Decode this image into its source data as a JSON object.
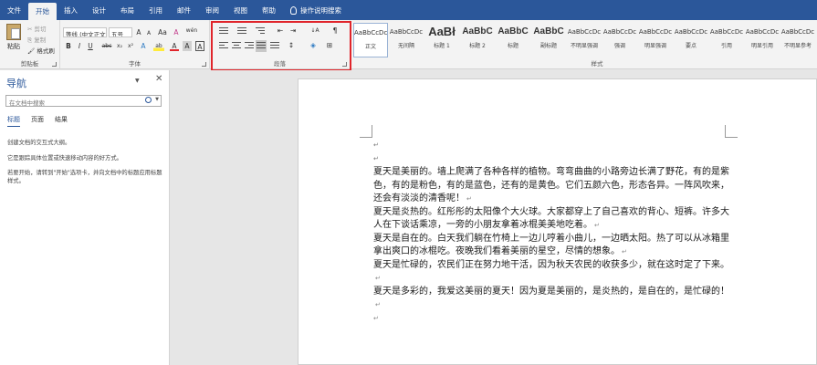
{
  "tabs": [
    "文件",
    "开始",
    "插入",
    "设计",
    "布局",
    "引用",
    "邮件",
    "审阅",
    "视图",
    "帮助",
    "操作说明搜索"
  ],
  "clipboard": {
    "paste": "粘贴",
    "cut": "剪切",
    "copy": "复制",
    "format_painter": "格式刷",
    "label": "剪贴板"
  },
  "font": {
    "name": "等线 (中文正文)",
    "size": "五号",
    "grow": "A",
    "shrink": "A",
    "case": "Aa",
    "clear": "A",
    "wen": "wén",
    "bold": "B",
    "italic": "I",
    "underline": "U",
    "strike": "abc",
    "sub": "x₂",
    "sup": "x²",
    "effects": "A",
    "highlight": "ab",
    "color": "A",
    "shade": "A",
    "label": "字体"
  },
  "paragraph": {
    "label": "段落"
  },
  "styles": {
    "label": "样式",
    "items": [
      {
        "sample": "AaBbCcDc",
        "name": "正文",
        "size": "small"
      },
      {
        "sample": "AaBbCcDc",
        "name": "无间隔",
        "size": "small"
      },
      {
        "sample": "AaBł",
        "name": "标题 1",
        "size": "big"
      },
      {
        "sample": "AaBbC",
        "name": "标题 2",
        "size": "mid"
      },
      {
        "sample": "AaBbC",
        "name": "标题",
        "size": "mid"
      },
      {
        "sample": "AaBbC",
        "name": "副标题",
        "size": "mid"
      },
      {
        "sample": "AaBbCcDc",
        "name": "不明显强调",
        "size": "small"
      },
      {
        "sample": "AaBbCcDc",
        "name": "强调",
        "size": "small"
      },
      {
        "sample": "AaBbCcDc",
        "name": "明显强调",
        "size": "small"
      },
      {
        "sample": "AaBbCcDc",
        "name": "要点",
        "size": "small"
      },
      {
        "sample": "AaBbCcDc",
        "name": "引用",
        "size": "small"
      },
      {
        "sample": "AaBbCcDc",
        "name": "明显引用",
        "size": "small"
      },
      {
        "sample": "AaBbCcDc",
        "name": "不明显参考",
        "size": "small"
      }
    ]
  },
  "nav": {
    "title": "导航",
    "search_placeholder": "在文档中搜索",
    "tabs": [
      "标题",
      "页面",
      "结果"
    ],
    "text1": "创建文档的交互式大纲。",
    "text2": "它是跟踪具体位置或快速移动内容的好方式。",
    "text3": "若要开始，请转到\"开始\"选项卡，并向文档中的标题应用标题样式。"
  },
  "document": {
    "paragraphs": [
      "夏天是美丽的。墙上爬满了各种各样的植物。弯弯曲曲的小路旁边长满了野花，有的是紫色，有的是粉色，有的是蓝色，还有的是黄色。它们五颜六色，形态各异。一阵风吹来，还会有淡淡的清香呢！",
      "夏天是炎热的。红彤彤的太阳像个大火球。大家都穿上了自己喜欢的背心、短裤。许多大人在下谈话乘凉，一旁的小朋友拿着冰棍美美地吃着。",
      "夏天是自在的。白天我们躺在竹椅上一边儿哼着小曲儿，一边晒太阳。热了可以从冰箱里拿出爽口的冰棍吃。夜晚我们看着美丽的星空，尽情的想象。",
      "夏天是忙碌的，农民们正在努力地干活，因为秋天农民的收获多少，就在这时定了下来。",
      "夏天是多彩的，我爱这美丽的夏天！因为夏是美丽的，是炎热的，是自在的，是忙碌的！"
    ]
  },
  "colors": {
    "word_blue": "#2b579a",
    "highlight_red": "#e0252b"
  }
}
